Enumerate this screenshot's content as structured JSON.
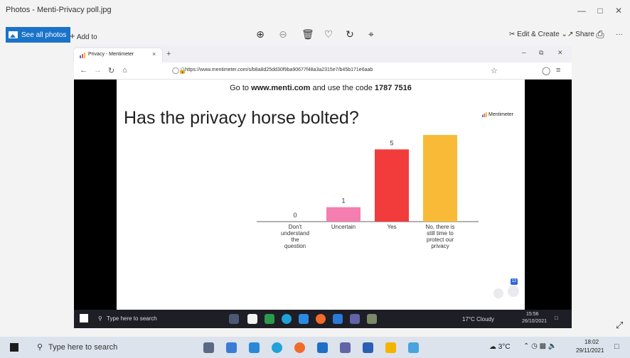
{
  "photos": {
    "title": "Photos - Menti-Privacy poll.jpg",
    "see_all": "See all photos",
    "add_to": "Add to",
    "edit_create": "Edit & Create",
    "share": "Share",
    "more": "···"
  },
  "browser": {
    "tab_title": "Privacy - Mentimeter",
    "url": "https://www.mentimeter.com/s/b8a8d25dd30f9ba90677f48a3a2315e7/b45b171e6aab"
  },
  "slide": {
    "join_prefix": "Go to ",
    "join_site": "www.menti.com",
    "join_middle": " and use the code ",
    "join_code": "1787 7516",
    "question": "Has the privacy horse bolted?",
    "brand": "Mentimeter",
    "participant_count": "12"
  },
  "chart_data": {
    "type": "bar",
    "categories": [
      "Don't understand the question",
      "Uncertain",
      "Yes",
      "No, there is still time to protect our privacy"
    ],
    "category_lines": [
      [
        "Don't",
        "understand",
        "the",
        "question"
      ],
      [
        "Uncertain"
      ],
      [
        "Yes"
      ],
      [
        "No, there is",
        "still time to",
        "protect our",
        "privacy"
      ]
    ],
    "values": [
      0,
      1,
      5,
      6
    ],
    "colors": [
      "#9aa0d6",
      "#f47eb0",
      "#f23b3b",
      "#f9bb37"
    ],
    "title": "",
    "xlabel": "",
    "ylabel": "",
    "ylim": [
      0,
      6
    ]
  },
  "inner_taskbar": {
    "search_placeholder": "Type here to search",
    "weather": "17°C Cloudy",
    "time": "15:56",
    "date": "26/10/2021"
  },
  "outer_taskbar": {
    "search_placeholder": "Type here to search",
    "weather": "3°C",
    "time": "18:02",
    "date": "29/11/2021"
  }
}
